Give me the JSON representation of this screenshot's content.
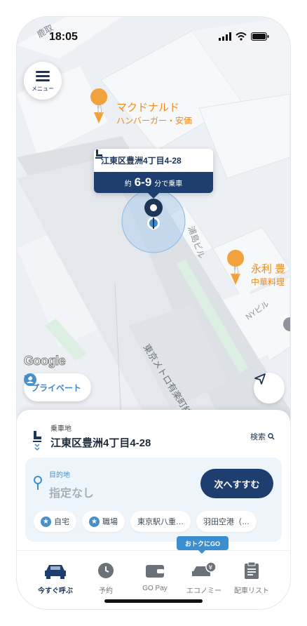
{
  "status_bar": {
    "time": "18:05"
  },
  "menu": {
    "label": "メニュー"
  },
  "map": {
    "pois": [
      {
        "name": "マクドナルド",
        "category": "ハンバーガー・安価"
      },
      {
        "name": "永利 豊",
        "category": "中華料理"
      }
    ],
    "labels": {
      "top_street": "鹿取",
      "building_1": "浦島ビル",
      "building_2": "NYビル",
      "rail_line": "東京メトロ有楽町線"
    },
    "attribution": "Google"
  },
  "pickup_bubble": {
    "address": "江東区豊洲4丁目4-28",
    "eta_prefix": "約",
    "eta_value": "6-9",
    "eta_suffix": "分で乗車"
  },
  "private_mode": {
    "label": "プライベート"
  },
  "sheet": {
    "pickup_label": "乗車地",
    "pickup_value": "江東区豊洲4丁目4-28",
    "search_label": "検索",
    "destination_label": "目的地",
    "destination_value": "指定なし",
    "next_button": "次へすすむ",
    "chips": [
      "自宅",
      "職場",
      "東京駅八重…",
      "羽田空港（…"
    ]
  },
  "promo_badge": "おトクにGO",
  "tabs": [
    {
      "label": "今すぐ呼ぶ",
      "icon": "car-icon",
      "active": true
    },
    {
      "label": "予約",
      "icon": "clock-icon",
      "active": false
    },
    {
      "label": "GO Pay",
      "icon": "wallet-icon",
      "active": false
    },
    {
      "label": "エコノミー",
      "icon": "economy-car-icon",
      "active": false
    },
    {
      "label": "配車リスト",
      "icon": "clipboard-icon",
      "active": false
    }
  ],
  "colors": {
    "navy": "#1d3e6e",
    "accent_blue": "#3b8fd0",
    "poi_orange": "#ee8b1b"
  }
}
